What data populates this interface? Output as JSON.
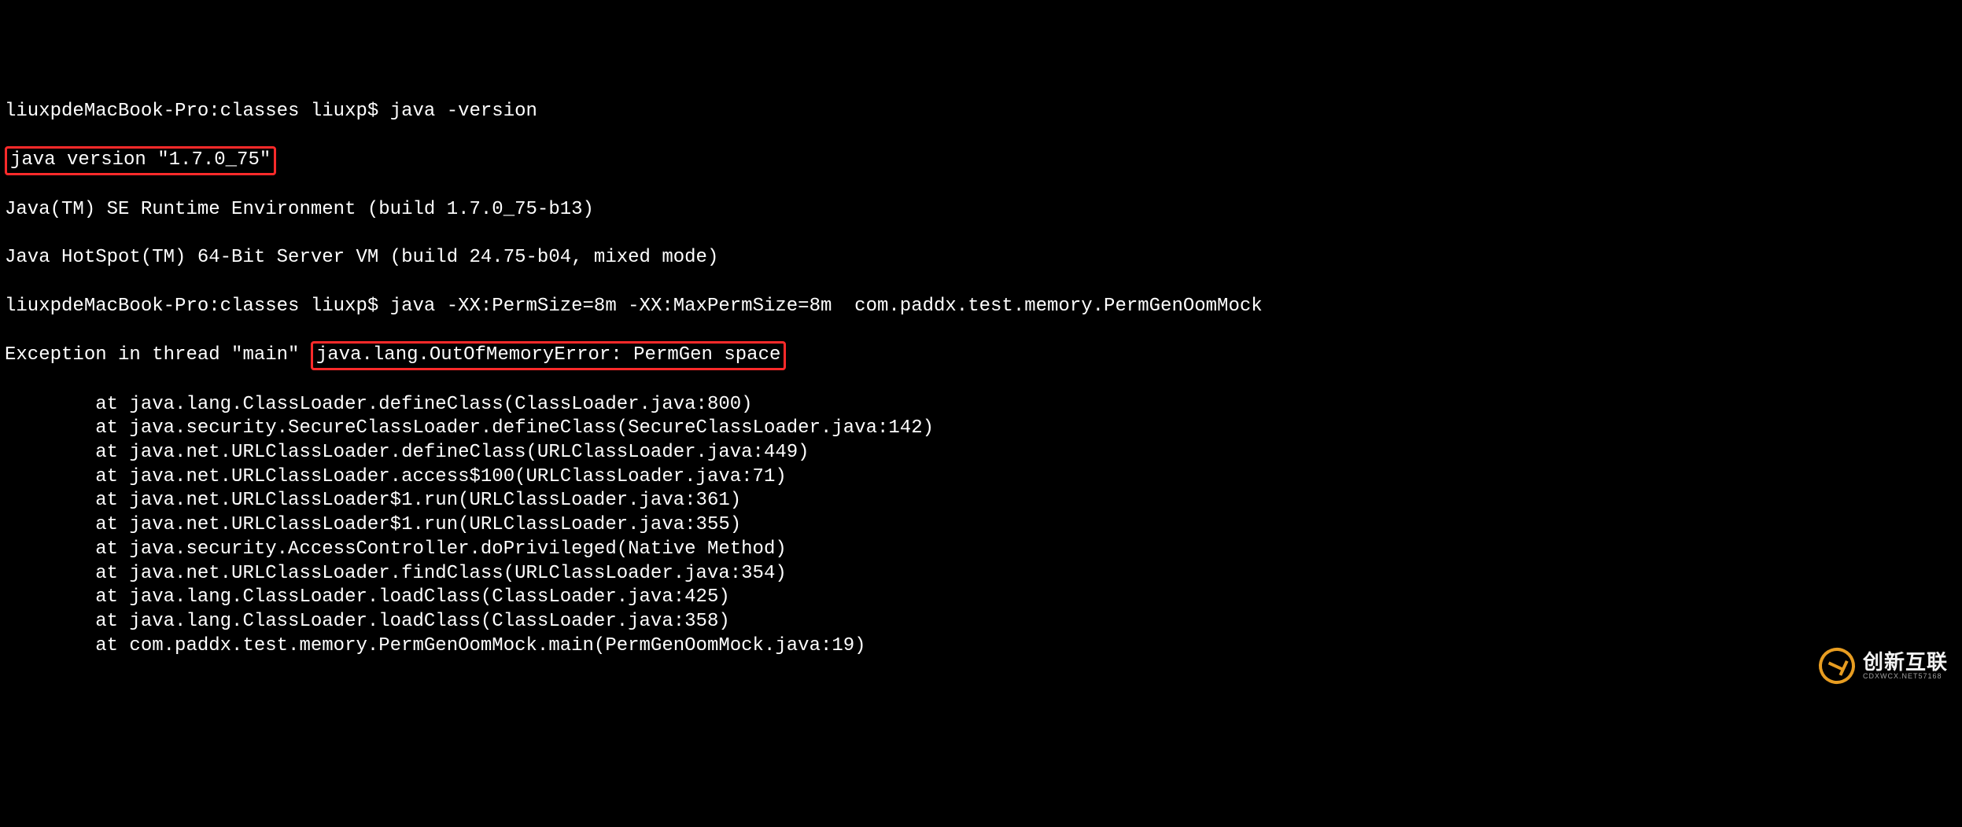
{
  "terminal": {
    "prompt1_prefix": "liuxpdeMacBook-Pro:classes liuxp$ ",
    "cmd1": "java -version",
    "version_box": "java version \"1.7.0_75\"",
    "runtime_line": "Java(TM) SE Runtime Environment (build 1.7.0_75-b13)",
    "hotspot_line": "Java HotSpot(TM) 64-Bit Server VM (build 24.75-b04, mixed mode)",
    "prompt2_prefix": "liuxpdeMacBook-Pro:classes liuxp$ ",
    "cmd2": "java -XX:PermSize=8m -XX:MaxPermSize=8m  com.paddx.test.memory.PermGenOomMock",
    "exception_prefix": "Exception in thread \"main\" ",
    "exception_box": "java.lang.OutOfMemoryError: PermGen space",
    "stack": [
      "        at java.lang.ClassLoader.defineClass(ClassLoader.java:800)",
      "        at java.security.SecureClassLoader.defineClass(SecureClassLoader.java:142)",
      "        at java.net.URLClassLoader.defineClass(URLClassLoader.java:449)",
      "        at java.net.URLClassLoader.access$100(URLClassLoader.java:71)",
      "        at java.net.URLClassLoader$1.run(URLClassLoader.java:361)",
      "        at java.net.URLClassLoader$1.run(URLClassLoader.java:355)",
      "        at java.security.AccessController.doPrivileged(Native Method)",
      "        at java.net.URLClassLoader.findClass(URLClassLoader.java:354)",
      "        at java.lang.ClassLoader.loadClass(ClassLoader.java:425)",
      "        at java.lang.ClassLoader.loadClass(ClassLoader.java:358)",
      "        at com.paddx.test.memory.PermGenOomMock.main(PermGenOomMock.java:19)"
    ]
  },
  "watermark": {
    "main": "创新互联",
    "sub": "CDXWCX.NET57168"
  }
}
